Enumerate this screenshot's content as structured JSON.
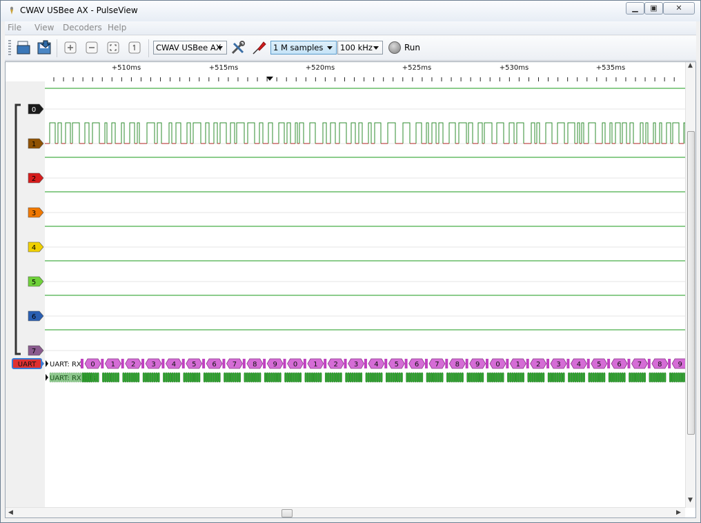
{
  "window": {
    "title": "CWAV USBee AX - PulseView"
  },
  "menu": {
    "file": "File",
    "view": "View",
    "decoders": "Decoders",
    "help": "Help"
  },
  "toolbar": {
    "device": "CWAV USBee AX",
    "samples": "1 M samples",
    "samplerate": "100 kHz",
    "run_label": "Run"
  },
  "ruler": {
    "labels": [
      "+510ms",
      "+515ms",
      "+520ms",
      "+525ms",
      "+530ms",
      "+535ms"
    ]
  },
  "channels": [
    {
      "label": "0",
      "color": "#1a1a1a"
    },
    {
      "label": "1",
      "color": "#8f5203"
    },
    {
      "label": "2",
      "color": "#d61c1c"
    },
    {
      "label": "3",
      "color": "#f07800"
    },
    {
      "label": "4",
      "color": "#f0d000"
    },
    {
      "label": "5",
      "color": "#6fd13a"
    },
    {
      "label": "6",
      "color": "#2a5fb2"
    },
    {
      "label": "7",
      "color": "#8a5b8e"
    }
  ],
  "decoder": {
    "label": "UART",
    "rows": [
      "UART: RX",
      "UART: RX bits"
    ],
    "values": [
      "0",
      "1",
      "2",
      "3",
      "4",
      "5",
      "6",
      "7",
      "8",
      "9",
      "0",
      "1",
      "2",
      "3",
      "4",
      "5",
      "6",
      "7",
      "8",
      "9",
      "0",
      "1",
      "2",
      "3",
      "4",
      "5",
      "6",
      "7",
      "8",
      "9"
    ]
  },
  "colors": {
    "grid_line": "#1a9a1a",
    "decoder_box": "#d56cd6",
    "bits_box": "#2fa52f",
    "signal_high": "#2e8b2e",
    "signal_low": "#b22222"
  }
}
